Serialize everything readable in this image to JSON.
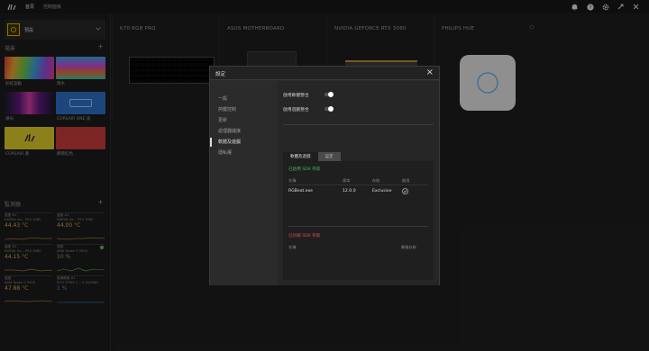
{
  "topbar": {
    "nav_home": "首頁",
    "nav_dashboard": "控制面板"
  },
  "sidebar": {
    "profile_name": "預設",
    "scenes_title": "場景",
    "scenes": [
      {
        "label": "彩虹波動",
        "color": "rainbow"
      },
      {
        "label": "雨水",
        "color": "rain"
      },
      {
        "label": "漸光",
        "color": "neon"
      },
      {
        "label": "CORSAIR ONE 波",
        "color": "#2d6cc0"
      },
      {
        "label": "CORSAIR 黃",
        "color": "#d8c52a"
      },
      {
        "label": "靜態紅色",
        "color": "#c23a3a"
      }
    ],
    "monitor_title": "監測器",
    "monitors": [
      {
        "line1": "溫度 #1",
        "line2": "NVIDIA Ge... RTX 3080",
        "value": "44.43 °C",
        "color": "#d6a44a",
        "dot": ""
      },
      {
        "line1": "溫度 #1",
        "line2": "NVIDIA Ge... RTX 3080",
        "value": "44.00 °C",
        "color": "#d6a44a",
        "dot": ""
      },
      {
        "line1": "溫度 #1",
        "line2": "NVIDIA Ge... RTX 3080",
        "value": "44.15 °C",
        "color": "#d6a44a",
        "dot": ""
      },
      {
        "line1": "負載",
        "line2": "AMD Ryzen 9 5900",
        "value": "10 %",
        "color": "#6fb35a",
        "dot": "#6fb35a"
      },
      {
        "line1": "溫度",
        "line2": "AMD Ryzen 9 5900",
        "value": "47.88 °C",
        "color": "#d6a44a",
        "dot": ""
      },
      {
        "line1": "風扇轉速 #1",
        "line2": "ROG STRIX C... II GAMING",
        "value": "1 %",
        "color": "#3c8ed6",
        "dot": ""
      }
    ]
  },
  "devices": [
    {
      "name": "K70 RGB PRO"
    },
    {
      "name": "ASUS MOTHERBOARD"
    },
    {
      "name": "NVIDIA GEFORCE RTX 3080"
    },
    {
      "name": "PHILIPS HUE"
    }
  ],
  "modal": {
    "title": "設定",
    "menu": [
      "一般",
      "熱鍵控制",
      "更新",
      "處理器鏈接",
      "軟體及遊戲",
      "隱私權"
    ],
    "active_menu": 4,
    "toggles": [
      {
        "label": "啟用軟體整合",
        "on": true
      },
      {
        "label": "啟用遊戲整合",
        "on": true
      }
    ],
    "tabs": [
      "軟體及遊戲",
      "設定"
    ],
    "supported_title": "已啟用 SDK 存取",
    "supported_color": "#45b35a",
    "columns": [
      "名稱",
      "版本",
      "存取",
      "啟用"
    ],
    "row": {
      "name": "RGBeat.exe",
      "version": "12.0.0",
      "access": "Exclusive"
    },
    "blocked_title": "已封鎖 SDK 存取",
    "blocked_color": "#d94b4b",
    "blocked_columns": [
      "名稱",
      "最後存取"
    ]
  }
}
